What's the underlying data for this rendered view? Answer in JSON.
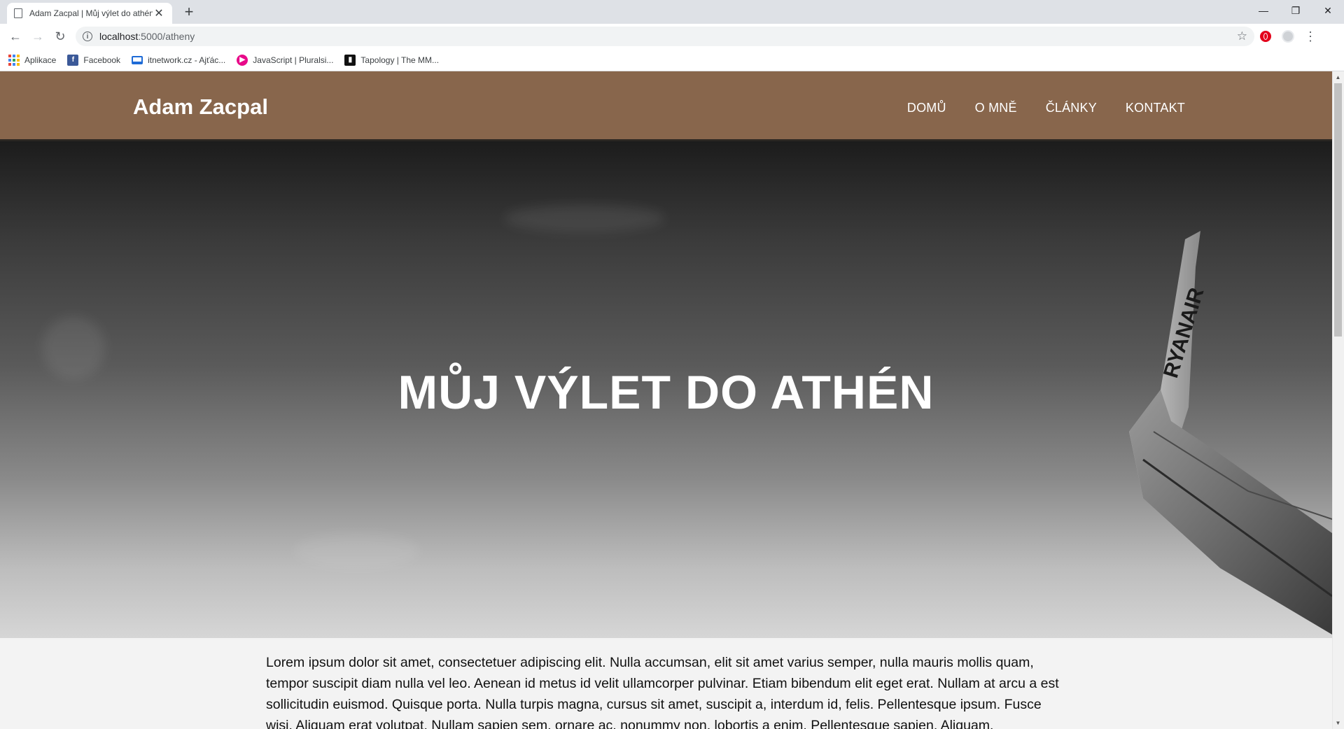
{
  "browser": {
    "tab_title": "Adam Zacpal | Můj výlet do athén",
    "url_host": "localhost",
    "url_path": ":5000/atheny",
    "bookmarks": [
      {
        "label": "Aplikace",
        "icon": "apps-grid-icon"
      },
      {
        "label": "Facebook",
        "icon": "facebook-icon"
      },
      {
        "label": "itnetwork.cz - Ajťác...",
        "icon": "laptop-icon"
      },
      {
        "label": "JavaScript | Pluralsi...",
        "icon": "pluralsight-icon"
      },
      {
        "label": "Tapology | The MM...",
        "icon": "tapology-icon"
      }
    ]
  },
  "site": {
    "logo": "Adam Zacpal",
    "nav": [
      "DOMŮ",
      "O MNĚ",
      "ČLÁNKY",
      "KONTAKT"
    ],
    "header_color": "#88664c"
  },
  "hero": {
    "title": "MŮJ VÝLET DO ATHÉN",
    "wing_text": "RYANAIR"
  },
  "article": {
    "body": "Lorem ipsum dolor sit amet, consectetuer adipiscing elit. Nulla accumsan, elit sit amet varius semper, nulla mauris mollis quam, tempor suscipit diam nulla vel leo. Aenean id metus id velit ullamcorper pulvinar. Etiam bibendum elit eget erat. Nullam at arcu a est sollicitudin euismod. Quisque porta. Nulla turpis magna, cursus sit amet, suscipit a, interdum id, felis. Pellentesque ipsum. Fusce wisi. Aliquam erat volutpat. Nullam sapien sem, ornare ac, nonummy non, lobortis a enim. Pellentesque sapien. Aliquam."
  }
}
